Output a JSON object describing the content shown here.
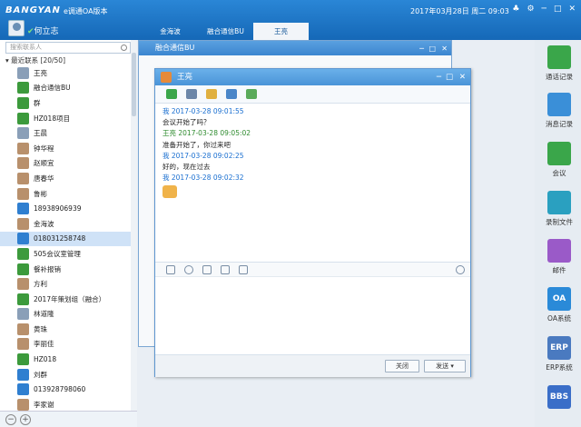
{
  "app": {
    "logo": "BANGYAN",
    "title": "e调通OA版本",
    "datetime": "2017年03月28日 周二 09:03"
  },
  "user": {
    "name": "何立志"
  },
  "tabs": [
    {
      "label": "金海波"
    },
    {
      "label": "融合通信BU"
    },
    {
      "label": "王亮"
    }
  ],
  "search": {
    "placeholder": "搜索联系人"
  },
  "group": {
    "label": "最近联系 [20/50]"
  },
  "contacts": [
    {
      "name": "王亮",
      "icon": "person"
    },
    {
      "name": "融合通信BU",
      "icon": "group"
    },
    {
      "name": "群",
      "icon": "group"
    },
    {
      "name": "HZ018项目",
      "icon": "group"
    },
    {
      "name": "王晨",
      "icon": "person"
    },
    {
      "name": "钟华程",
      "icon": "photo"
    },
    {
      "name": "赵顺宜",
      "icon": "photo"
    },
    {
      "name": "唐春华",
      "icon": "photo"
    },
    {
      "name": "鲁彬",
      "icon": "photo"
    },
    {
      "name": "18938906939",
      "icon": "phone"
    },
    {
      "name": "金海波",
      "icon": "photo"
    },
    {
      "name": "018031258748",
      "icon": "phone",
      "selected": true
    },
    {
      "name": "505会议室管理",
      "icon": "group"
    },
    {
      "name": "餐补报销",
      "icon": "group"
    },
    {
      "name": "方利",
      "icon": "photo"
    },
    {
      "name": "2017年策划组（融合）",
      "icon": "group"
    },
    {
      "name": "林道隆",
      "icon": "person"
    },
    {
      "name": "黄珠",
      "icon": "photo"
    },
    {
      "name": "李丽佳",
      "icon": "photo"
    },
    {
      "name": "HZ018",
      "icon": "group"
    },
    {
      "name": "刘群",
      "icon": "phone"
    },
    {
      "name": "013928798060",
      "icon": "phone"
    },
    {
      "name": "李家谢",
      "icon": "photo"
    }
  ],
  "window_group": {
    "title": "融合通信BU"
  },
  "chat": {
    "title": "王亮",
    "messages": [
      {
        "sender": "我 2017-03-28 09:01:55",
        "text": "会议开始了吗？",
        "me": true
      },
      {
        "sender": "王亮 2017-03-28 09:05:02",
        "text": "准备开始了，你过来吧",
        "me": false
      },
      {
        "sender": "我 2017-03-28 09:02:25",
        "text": "好的，现在过去",
        "me": true
      },
      {
        "sender": "我 2017-03-28 09:02:32",
        "text": "",
        "me": true
      }
    ],
    "close_label": "关闭",
    "send_label": "发送"
  },
  "right_panel": [
    {
      "label": "通话记录",
      "icon": "phone-icon",
      "color": "#3aa64a",
      "text": ""
    },
    {
      "label": "消息记录",
      "icon": "message-icon",
      "color": "#3a8fd8",
      "text": ""
    },
    {
      "label": "会议",
      "icon": "meeting-icon",
      "color": "#3aa64a",
      "text": ""
    },
    {
      "label": "录制文件",
      "icon": "recording-icon",
      "color": "#2aa0c0",
      "text": ""
    },
    {
      "label": "邮件",
      "icon": "mail-icon",
      "color": "#9a5ac8",
      "text": ""
    },
    {
      "label": "OA系统",
      "icon": "oa-icon",
      "color": "#2a8ad8",
      "text": "OA"
    },
    {
      "label": "ERP系统",
      "icon": "erp-icon",
      "color": "#4a7ac0",
      "text": "ERP"
    },
    {
      "label": "",
      "icon": "bbs-icon",
      "color": "#3a6ec8",
      "text": "BBS"
    }
  ]
}
